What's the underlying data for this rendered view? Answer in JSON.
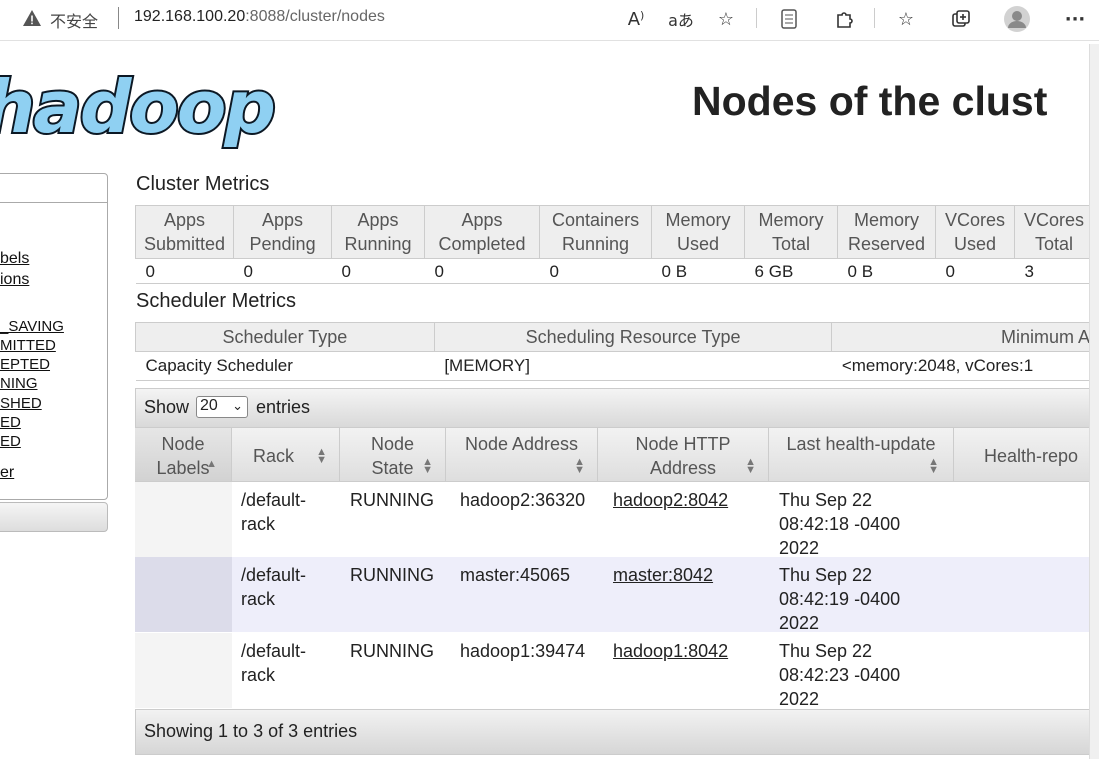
{
  "browser": {
    "insecure_label": "不安全",
    "url_host": "192.168.100.20",
    "url_rest": ":8088/cluster/nodes",
    "toolbar_icons": [
      "read-aloud-icon",
      "translate-icon",
      "add-favorite-icon",
      "split-screen-icon",
      "extensions-icon",
      "favorites-icon",
      "collections-icon",
      "profile-icon",
      "more-icon"
    ]
  },
  "header": {
    "logo_text": "hadoop",
    "title": "Nodes of the clust"
  },
  "nav": {
    "items": [
      "bels",
      "ions",
      "_SAVING",
      "MITTED",
      "EPTED",
      "NING",
      "SHED",
      "ED",
      "ED",
      "er"
    ]
  },
  "cluster_metrics": {
    "title": "Cluster Metrics",
    "columns": [
      [
        "Apps",
        "Submitted"
      ],
      [
        "Apps",
        "Pending"
      ],
      [
        "Apps",
        "Running"
      ],
      [
        "Apps",
        "Completed"
      ],
      [
        "Containers",
        "Running"
      ],
      [
        "Memory",
        "Used"
      ],
      [
        "Memory",
        "Total"
      ],
      [
        "Memory",
        "Reserved"
      ],
      [
        "VCores",
        "Used"
      ],
      [
        "VCores",
        "Total"
      ]
    ],
    "values": [
      "0",
      "0",
      "0",
      "0",
      "0",
      "0 B",
      "6 GB",
      "0 B",
      "0",
      "3"
    ]
  },
  "scheduler_metrics": {
    "title": "Scheduler Metrics",
    "columns": [
      "Scheduler Type",
      "Scheduling Resource Type",
      "Minimum A"
    ],
    "values": [
      "Capacity Scheduler",
      "[MEMORY]",
      "<memory:2048, vCores:1"
    ]
  },
  "nodes_table": {
    "show_label": "Show",
    "page_size": "20",
    "entries_label": "entries",
    "columns": [
      [
        "Node",
        "Labels"
      ],
      [
        "Rack"
      ],
      [
        "Node",
        "State"
      ],
      [
        "Node Address"
      ],
      [
        "Node HTTP",
        "Address"
      ],
      [
        "Last health-update"
      ],
      [
        "Health-repo"
      ]
    ],
    "rows": [
      {
        "labels": "",
        "rack": [
          "/default-",
          "rack"
        ],
        "state": "RUNNING",
        "address": "hadoop2:36320",
        "http": "hadoop2:8042",
        "health": [
          "Thu Sep 22",
          "08:42:18 -0400",
          "2022"
        ]
      },
      {
        "labels": "",
        "rack": [
          "/default-",
          "rack"
        ],
        "state": "RUNNING",
        "address": "master:45065",
        "http": "master:8042",
        "health": [
          "Thu Sep 22",
          "08:42:19 -0400",
          "2022"
        ]
      },
      {
        "labels": "",
        "rack": [
          "/default-",
          "rack"
        ],
        "state": "RUNNING",
        "address": "hadoop1:39474",
        "http": "hadoop1:8042",
        "health": [
          "Thu Sep 22",
          "08:42:23 -0400",
          "2022"
        ]
      }
    ],
    "footer": "Showing 1 to 3 of 3 entries"
  },
  "colors": {
    "row_odd_bg": "#ffffff",
    "row_even_bg": "#eeeefa",
    "label_cell_odd": "#f4f4f4",
    "label_cell_even": "#dcdcea",
    "logo_fill": "#8fd0f2"
  }
}
